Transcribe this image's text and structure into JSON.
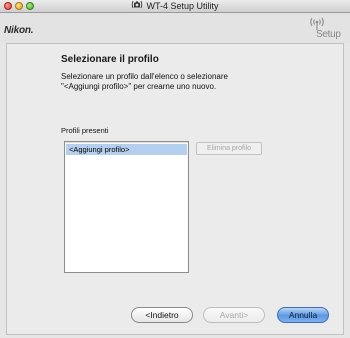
{
  "window": {
    "title": "WT-4 Setup Utility",
    "title_icon": "camera-wifi-icon"
  },
  "header": {
    "brand": "Nikon.",
    "setup_label": "Setup",
    "setup_icon": "wireless-waves-icon"
  },
  "page": {
    "heading": "Selezionare il profilo",
    "instructions_line1": "Selezionare un profilo dall'elenco o selezionare",
    "instructions_line2": "\"<Aggiungi profilo>\" per crearne uno nuovo.",
    "profiles_label": "Profili presenti",
    "profiles": [
      {
        "label": "<Aggiungi profilo>",
        "selected": true
      }
    ],
    "delete_button": "Elimina profilo"
  },
  "footer": {
    "back": "<Indietro",
    "next": "Avanti>",
    "cancel": "Annulla"
  },
  "colors": {
    "selection": "#b5cfef",
    "default_button": "#5b98e2",
    "disabled_text": "#a5a5a5"
  }
}
